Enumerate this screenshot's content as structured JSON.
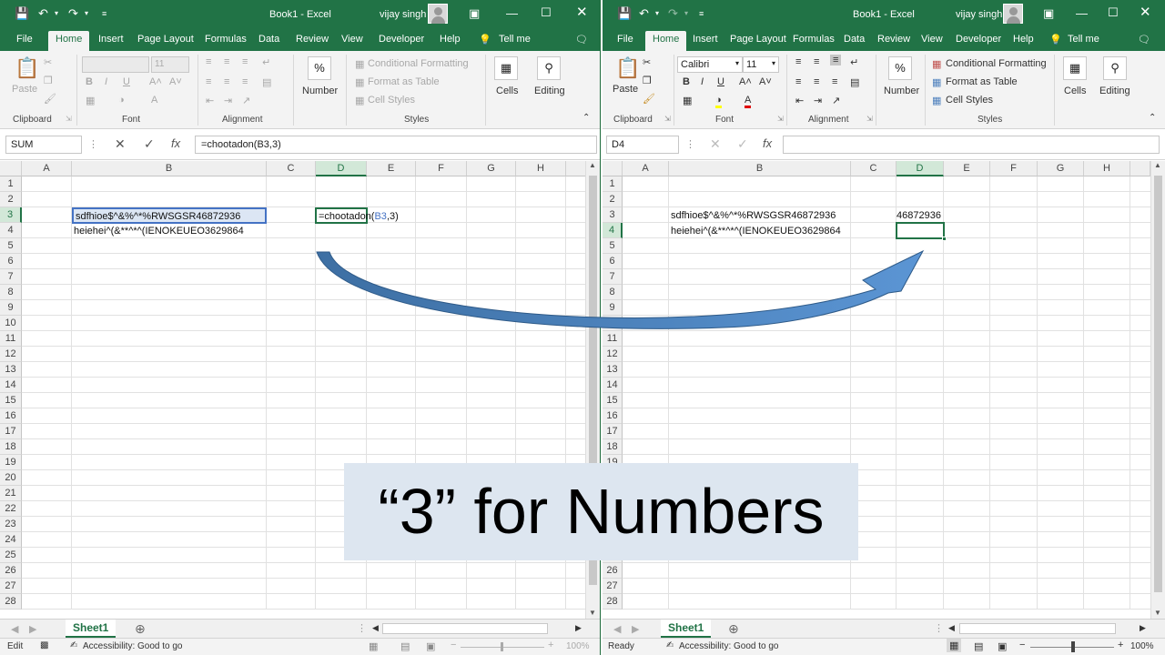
{
  "colors": {
    "excel_green": "#217346",
    "arrow_blue": "#4f81bd",
    "caption_bg": "#dde6f0"
  },
  "left": {
    "title": "Book1  -  Excel",
    "user": "vijay singh",
    "tabs": [
      "File",
      "Home",
      "Insert",
      "Page Layout",
      "Formulas",
      "Data",
      "Review",
      "View",
      "Developer",
      "Help",
      "Tell me"
    ],
    "ribbon": {
      "paste": "Paste",
      "font_name": "",
      "font_size": "11",
      "number": "Number",
      "cond_format": "Conditional Formatting",
      "format_table": "Format as Table",
      "cell_styles": "Cell Styles",
      "cells": "Cells",
      "editing": "Editing",
      "groups": [
        "Clipboard",
        "Font",
        "Alignment",
        "Styles"
      ]
    },
    "name_box": "SUM",
    "formula": "=chootadon(B3,3)",
    "columns": [
      "A",
      "B",
      "C",
      "D",
      "E",
      "F",
      "G",
      "H"
    ],
    "rows": [
      "1",
      "2",
      "3",
      "4",
      "5",
      "6",
      "7",
      "8",
      "9",
      "10",
      "11",
      "12",
      "13",
      "14",
      "15",
      "16",
      "17",
      "18",
      "19",
      "20",
      "21",
      "22",
      "23",
      "24",
      "25",
      "26",
      "27",
      "28"
    ],
    "cells": {
      "B3": "sdfhioe$^&%^*%RWSGSR46872936",
      "B4": "heiehei^(&**^*^(IENOKEUEO3629864",
      "D3_pre": "=chootadon(",
      "D3_ref": "B3",
      "D3_post": ",3)"
    },
    "sheet": "Sheet1",
    "status": {
      "mode": "Edit",
      "accessibility": "Accessibility: Good to go",
      "zoom": "100%"
    }
  },
  "right": {
    "title": "Book1  -  Excel",
    "user": "vijay singh",
    "tabs": [
      "File",
      "Home",
      "Insert",
      "Page Layout",
      "Formulas",
      "Data",
      "Review",
      "View",
      "Developer",
      "Help",
      "Tell me"
    ],
    "ribbon": {
      "paste": "Paste",
      "font_name": "Calibri",
      "font_size": "11",
      "number": "Number",
      "cond_format": "Conditional Formatting",
      "format_table": "Format as Table",
      "cell_styles": "Cell Styles",
      "cells": "Cells",
      "editing": "Editing",
      "groups": [
        "Clipboard",
        "Font",
        "Alignment",
        "Styles"
      ]
    },
    "name_box": "D4",
    "formula": "",
    "columns": [
      "A",
      "B",
      "C",
      "D",
      "E",
      "F",
      "G",
      "H"
    ],
    "rows": [
      "1",
      "2",
      "3",
      "4",
      "5",
      "6",
      "7",
      "8",
      "9",
      "10",
      "11",
      "12",
      "13",
      "14",
      "15",
      "16",
      "17",
      "18",
      "19",
      "20",
      "21",
      "22",
      "23",
      "24",
      "25",
      "26",
      "27",
      "28"
    ],
    "cells": {
      "B3": "sdfhioe$^&%^*%RWSGSR46872936",
      "B4": "heiehei^(&**^*^(IENOKEUEO3629864",
      "D3": "46872936"
    },
    "sheet": "Sheet1",
    "status": {
      "mode": "Ready",
      "accessibility": "Accessibility: Good to go",
      "zoom": "100%"
    }
  },
  "caption": "“3” for Numbers"
}
